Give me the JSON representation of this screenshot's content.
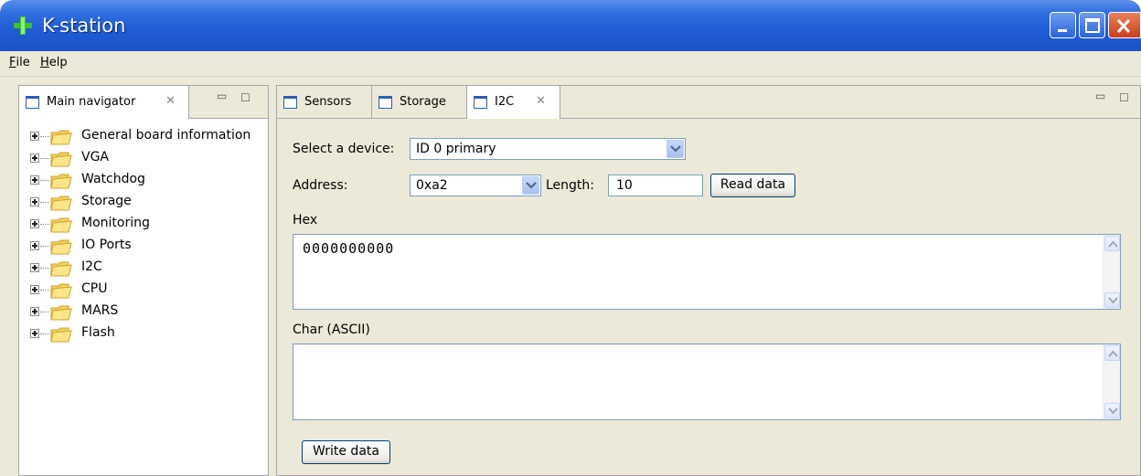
{
  "window": {
    "title": "K-station",
    "accent_color": "#2f6fde",
    "controls": [
      "minimize-icon",
      "maximize-icon",
      "close-icon"
    ]
  },
  "menu": {
    "file": {
      "mnemonic": "F",
      "rest": "ile"
    },
    "help": {
      "mnemonic": "H",
      "rest": "elp"
    }
  },
  "navigator": {
    "tab_label": "Main navigator",
    "tab_icon": "view-icon",
    "items": [
      {
        "label": "General board information"
      },
      {
        "label": "VGA"
      },
      {
        "label": "Watchdog"
      },
      {
        "label": "Storage"
      },
      {
        "label": "Monitoring"
      },
      {
        "label": "IO Ports"
      },
      {
        "label": "I2C"
      },
      {
        "label": "CPU"
      },
      {
        "label": "MARS"
      },
      {
        "label": "Flash"
      }
    ]
  },
  "editor": {
    "tabs": [
      {
        "label": "Sensors",
        "active": false
      },
      {
        "label": "Storage",
        "active": false
      },
      {
        "label": "I2C",
        "active": true
      }
    ]
  },
  "i2c": {
    "device_label": "Select a device:",
    "device_value": "ID 0 primary",
    "address_label": "Address:",
    "address_value": "0xa2",
    "length_label": "Length:",
    "length_value": "10",
    "read_button": "Read data",
    "hex_label": "Hex",
    "hex_value": "0000000000",
    "char_label": "Char (ASCII)",
    "char_value": "",
    "write_button": "Write data"
  }
}
